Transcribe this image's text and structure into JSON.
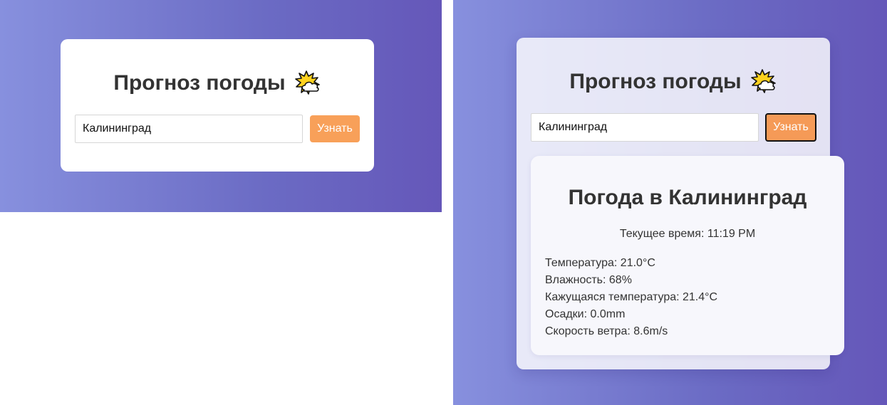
{
  "left_view": {
    "title": "Прогноз погоды",
    "title_icon": "sun-behind-cloud-icon",
    "city_input_value": "Калининград",
    "submit_label": "Узнать"
  },
  "right_view": {
    "title": "Прогноз погоды",
    "title_icon": "sun-behind-cloud-icon",
    "city_input_value": "Калининград",
    "submit_label": "Узнать",
    "result": {
      "heading": "Погода в Калининград",
      "current_time": "Текущее время: 11:19 PM",
      "details": [
        "Температура: 21.0°C",
        "Влажность: 68%",
        "Кажущаяся температура: 21.4°C",
        "Осадки: 0.0mm",
        "Скорость ветра: 8.6m/s"
      ]
    }
  },
  "colors": {
    "gradient_start": "#8790de",
    "gradient_end": "#6557b9",
    "button": "#f8a059",
    "title_text": "#333333"
  }
}
